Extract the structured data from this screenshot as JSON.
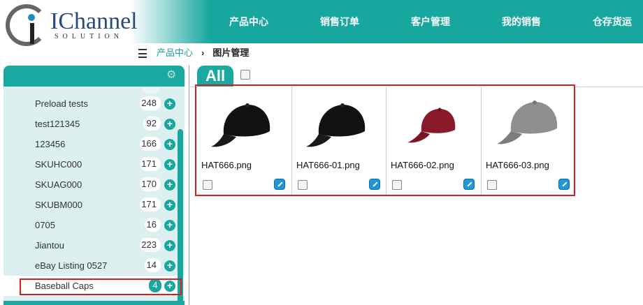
{
  "app": {
    "logo_text": "IChannel",
    "logo_subtext": "SOLUTION"
  },
  "nav": {
    "items": [
      {
        "label": "产品中心"
      },
      {
        "label": "销售订单"
      },
      {
        "label": "客户管理"
      },
      {
        "label": "我的销售"
      },
      {
        "label": "仓存货运"
      }
    ]
  },
  "breadcrumb": {
    "items": [
      {
        "label": "产品中心"
      },
      {
        "label": "图片管理"
      }
    ]
  },
  "sidebar": {
    "gear_icon": "gear-icon",
    "items": [
      {
        "label": "Preload tests",
        "count": "248"
      },
      {
        "label": "test121345",
        "count": "92"
      },
      {
        "label": "123456",
        "count": "166"
      },
      {
        "label": "SKUHC000",
        "count": "171"
      },
      {
        "label": "SKUAG000",
        "count": "170"
      },
      {
        "label": "SKUBM000",
        "count": "171"
      },
      {
        "label": "0705",
        "count": "16"
      },
      {
        "label": "Jiantou",
        "count": "223"
      },
      {
        "label": "eBay Listing 0527",
        "count": "14"
      },
      {
        "label": "Baseball Caps",
        "count": "4"
      }
    ],
    "selected_item": "Baseball Caps"
  },
  "main": {
    "tabs": [
      {
        "label": "All"
      }
    ],
    "images": [
      {
        "filename": "HAT666.png",
        "color": "#111111"
      },
      {
        "filename": "HAT666-01.png",
        "color": "#111111"
      },
      {
        "filename": "HAT666-02.png",
        "color": "#8a1a2a"
      },
      {
        "filename": "HAT666-03.png",
        "color": "#8f8f8f"
      }
    ]
  },
  "colors": {
    "accent": "#17a79f",
    "highlight_border": "#d42020",
    "edit_icon": "#2196d8"
  }
}
